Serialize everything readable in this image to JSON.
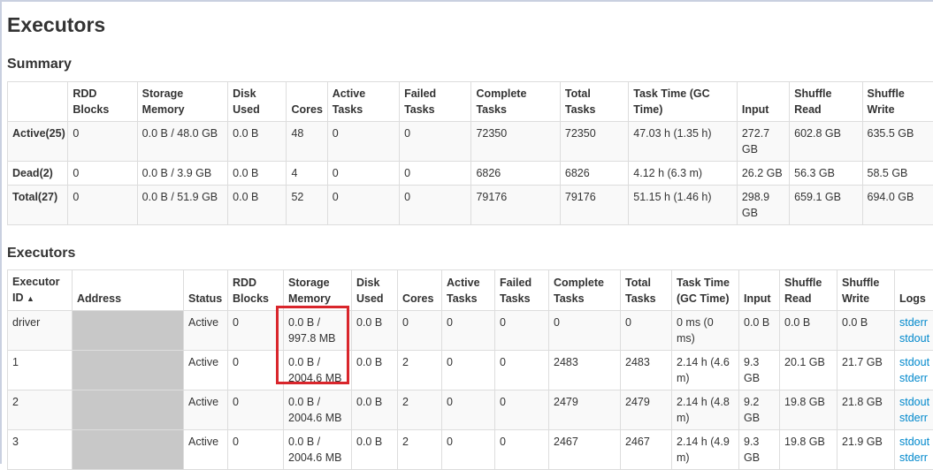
{
  "page_title": "Executors",
  "summary": {
    "heading": "Summary",
    "columns": [
      "",
      "RDD Blocks",
      "Storage Memory",
      "Disk Used",
      "Cores",
      "Active Tasks",
      "Failed Tasks",
      "Complete Tasks",
      "Total Tasks",
      "Task Time (GC Time)",
      "Input",
      "Shuffle Read",
      "Shuffle Write"
    ],
    "rows": [
      [
        "Active(25)",
        "0",
        "0.0 B / 48.0 GB",
        "0.0 B",
        "48",
        "0",
        "0",
        "72350",
        "72350",
        "47.03 h (1.35 h)",
        "272.7 GB",
        "602.8 GB",
        "635.5 GB"
      ],
      [
        "Dead(2)",
        "0",
        "0.0 B / 3.9 GB",
        "0.0 B",
        "4",
        "0",
        "0",
        "6826",
        "6826",
        "4.12 h (6.3 m)",
        "26.2 GB",
        "56.3 GB",
        "58.5 GB"
      ],
      [
        "Total(27)",
        "0",
        "0.0 B / 51.9 GB",
        "0.0 B",
        "52",
        "0",
        "0",
        "79176",
        "79176",
        "51.15 h (1.46 h)",
        "298.9 GB",
        "659.1 GB",
        "694.0 GB"
      ]
    ]
  },
  "executors": {
    "heading": "Executors",
    "columns": [
      "Executor ID",
      "Address",
      "Status",
      "RDD Blocks",
      "Storage Memory",
      "Disk Used",
      "Cores",
      "Active Tasks",
      "Failed Tasks",
      "Complete Tasks",
      "Total Tasks",
      "Task Time (GC Time)",
      "Input",
      "Shuffle Read",
      "Shuffle Write",
      "Logs"
    ],
    "sort_indicator": "▲",
    "rows": [
      {
        "id": "driver",
        "status": "Active",
        "rdd": "0",
        "storage": "0.0 B / 997.8 MB",
        "disk": "0.0 B",
        "cores": "0",
        "active": "0",
        "failed": "0",
        "complete": "0",
        "total": "0",
        "task_time": "0 ms (0 ms)",
        "input": "0.0 B",
        "shuffle_read": "0.0 B",
        "shuffle_write": "0.0 B",
        "logs": [
          "stderr",
          "stdout"
        ]
      },
      {
        "id": "1",
        "status": "Active",
        "rdd": "0",
        "storage": "0.0 B / 2004.6 MB",
        "disk": "0.0 B",
        "cores": "2",
        "active": "0",
        "failed": "0",
        "complete": "2483",
        "total": "2483",
        "task_time": "2.14 h (4.6 m)",
        "input": "9.3 GB",
        "shuffle_read": "20.1 GB",
        "shuffle_write": "21.7 GB",
        "logs": [
          "stdout",
          "stderr"
        ]
      },
      {
        "id": "2",
        "status": "Active",
        "rdd": "0",
        "storage": "0.0 B / 2004.6 MB",
        "disk": "0.0 B",
        "cores": "2",
        "active": "0",
        "failed": "0",
        "complete": "2479",
        "total": "2479",
        "task_time": "2.14 h (4.8 m)",
        "input": "9.2 GB",
        "shuffle_read": "19.8 GB",
        "shuffle_write": "21.8 GB",
        "logs": [
          "stdout",
          "stderr"
        ]
      },
      {
        "id": "3",
        "status": "Active",
        "rdd": "0",
        "storage": "0.0 B / 2004.6 MB",
        "disk": "0.0 B",
        "cores": "2",
        "active": "0",
        "failed": "0",
        "complete": "2467",
        "total": "2467",
        "task_time": "2.14 h (4.9 m)",
        "input": "9.3 GB",
        "shuffle_read": "19.8 GB",
        "shuffle_write": "21.9 GB",
        "logs": [
          "stdout",
          "stderr"
        ]
      }
    ]
  },
  "colors": {
    "link": "#0088cc",
    "highlight": "#d9262c",
    "redacted": "#c8c8c8"
  }
}
